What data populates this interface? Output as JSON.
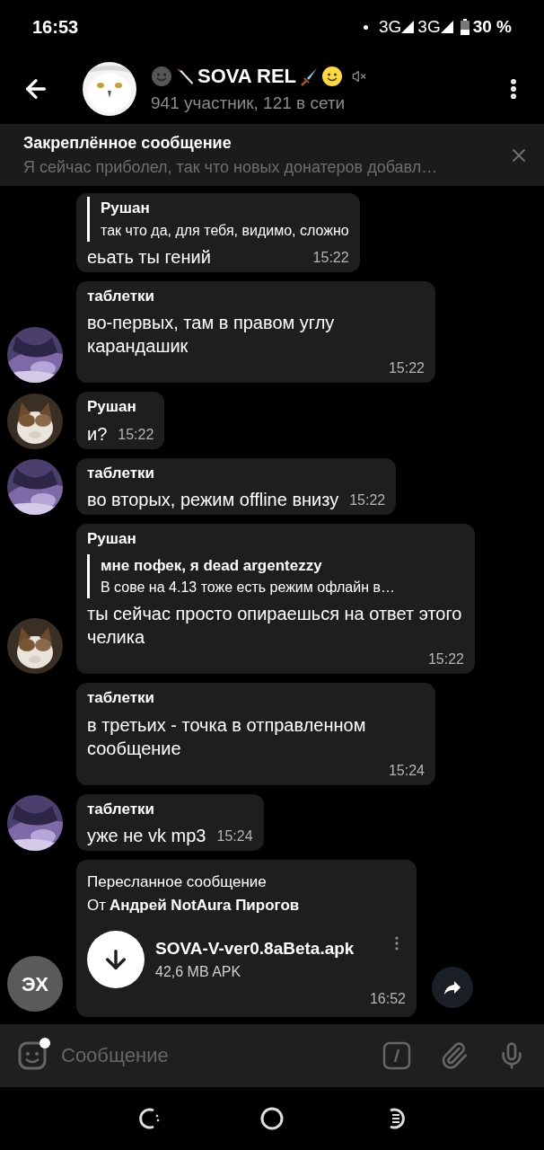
{
  "status_bar": {
    "time": "16:53",
    "network_1": "3G",
    "network_2": "3G",
    "battery": "30 %"
  },
  "header": {
    "title": "SOVA REL",
    "subtitle": "941 участник, 121 в сети",
    "muted": true
  },
  "pinned": {
    "title": "Закреплённое сообщение",
    "text": "Я сейчас приболел, так что новых донатеров добавл…"
  },
  "messages": [
    {
      "kind": "reply",
      "reply_author": "Рушан",
      "reply_text": "так что  да, для тебя, видимо, сложно",
      "text": "еьать ты гений",
      "time": "15:22"
    },
    {
      "kind": "text",
      "sender": "таблетки",
      "text": "во-первых, там в правом углу карандашик",
      "time": "15:22"
    },
    {
      "kind": "text",
      "sender": "Рушан",
      "text": "и?",
      "time": "15:22"
    },
    {
      "kind": "text",
      "sender": "таблетки",
      "text": "во вторых, режим offline внизу",
      "time": "15:22"
    },
    {
      "kind": "reply",
      "sender": "Рушан",
      "reply_author": "мне пофек, я dead argentezzy",
      "reply_text": "В сове на 4.13 тоже есть режим офлайн в…",
      "text": "ты сейчас просто опираешься на ответ этого челика",
      "time": "15:22"
    },
    {
      "kind": "text",
      "sender": "таблетки",
      "text": "в третьих - точка в отправленном сообщение",
      "time": "15:24"
    },
    {
      "kind": "text",
      "sender": "таблетки",
      "text": "уже не vk mp3",
      "time": "15:24"
    },
    {
      "kind": "file",
      "forward_label": "Пересланное сообщение",
      "from_prefix": "От",
      "from_name": "Андрей NotAura Пирогов",
      "file_name": "SOVA-V-ver0.8aBeta.apk",
      "file_size": "42,6 MB APK",
      "time": "16:52",
      "avatar_initials": "ЭХ"
    }
  ],
  "composer": {
    "placeholder": "Сообщение"
  }
}
